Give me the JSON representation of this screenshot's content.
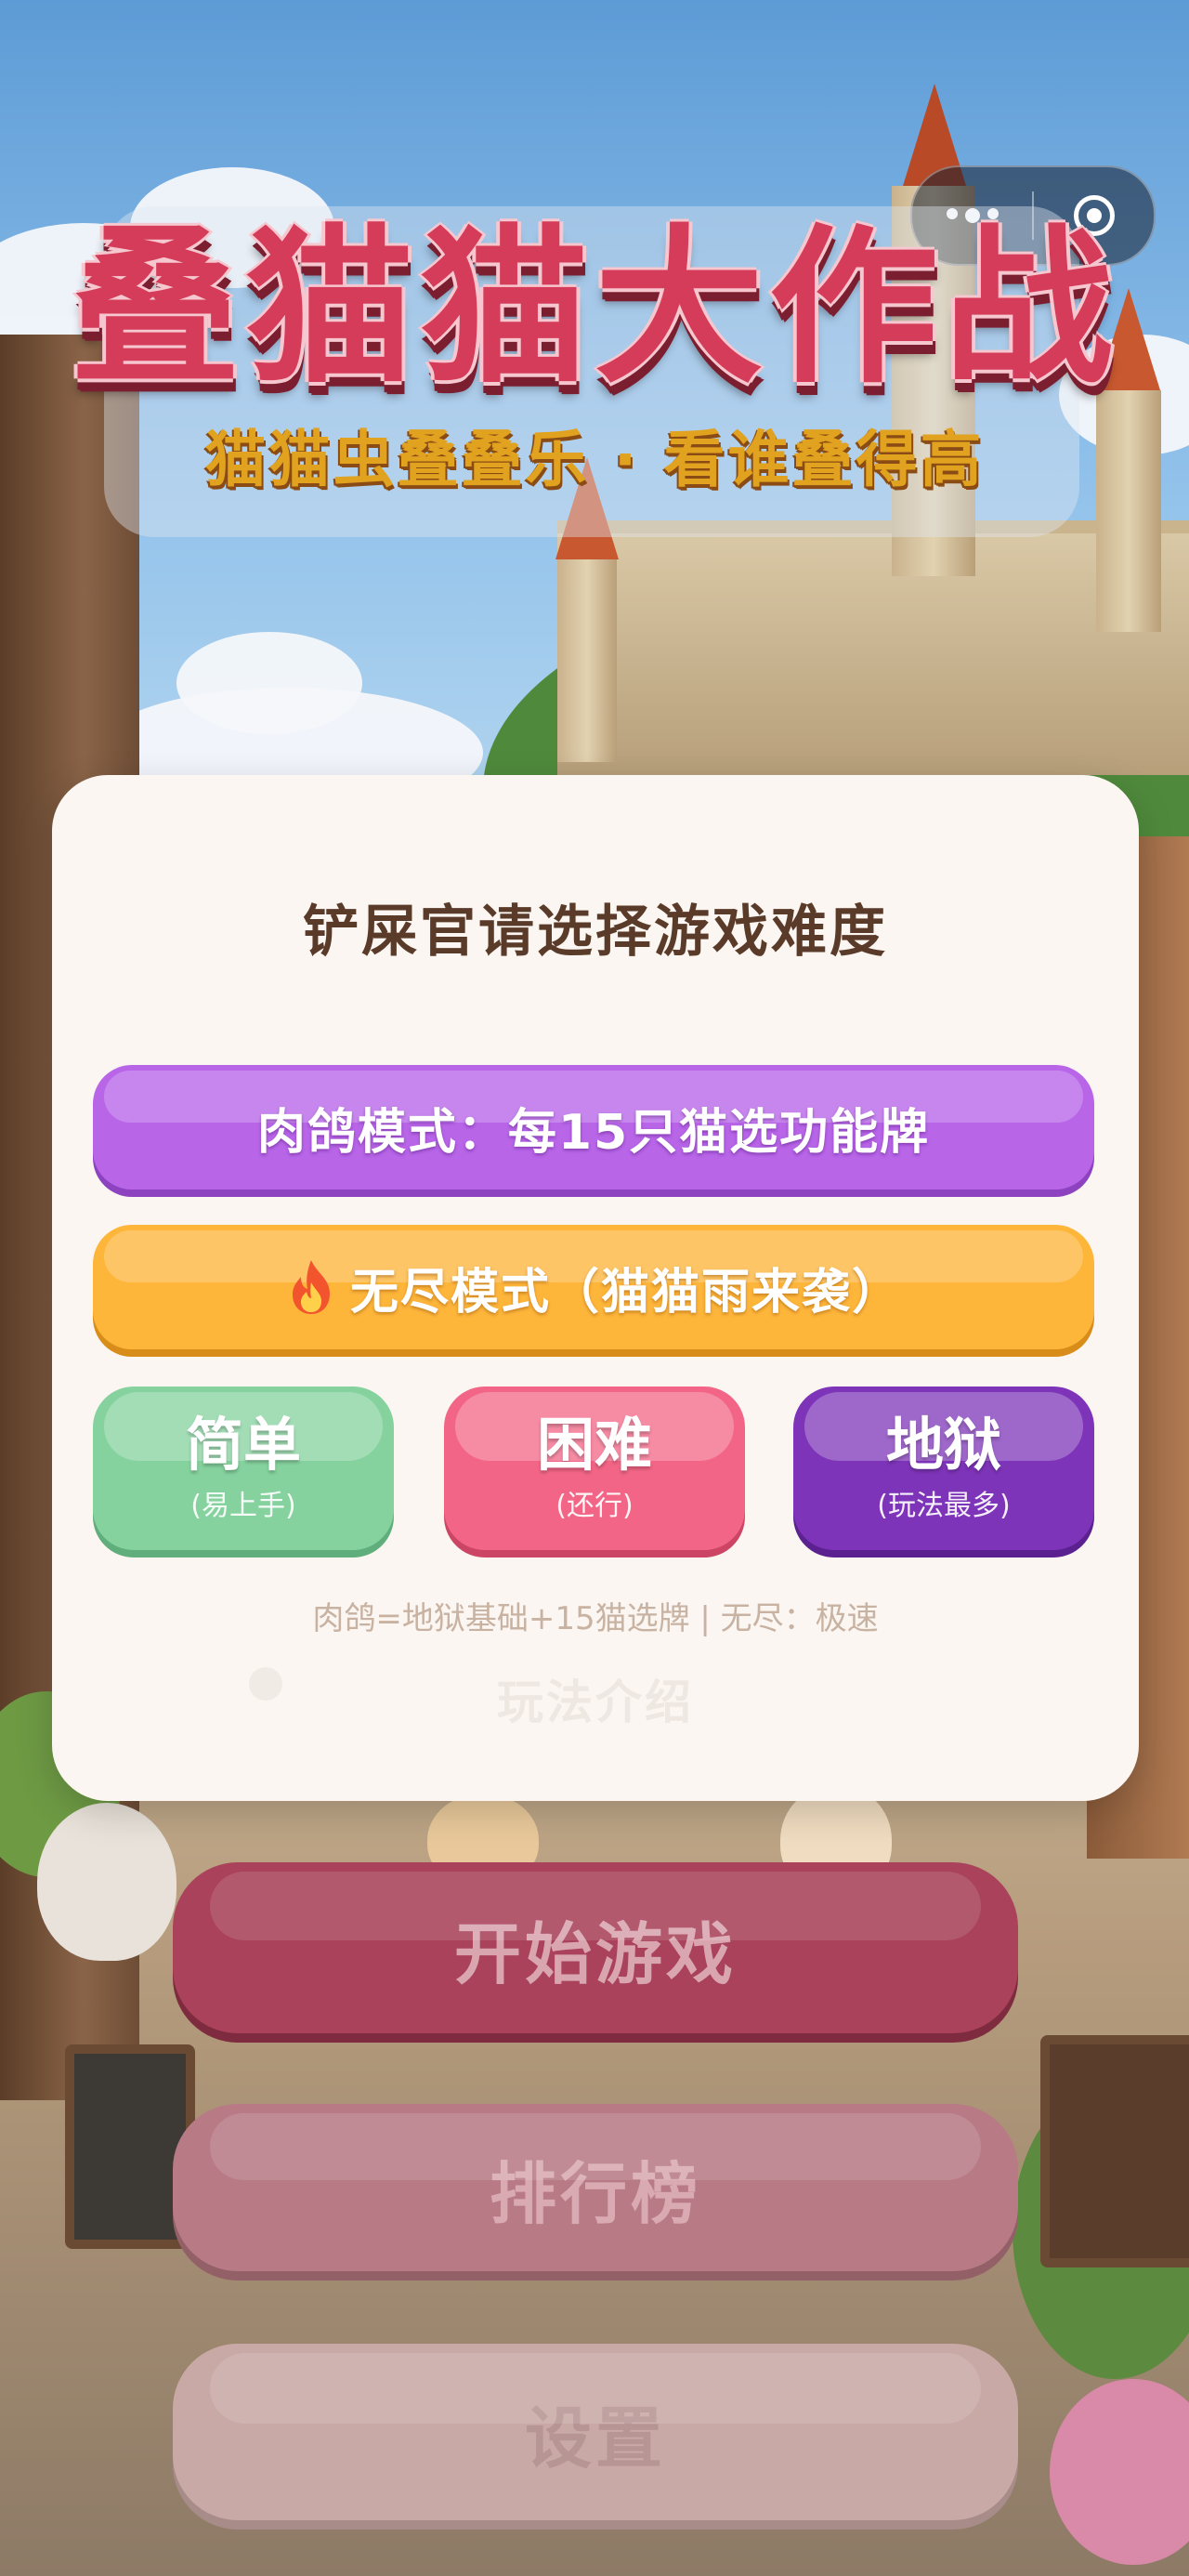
{
  "header": {
    "title": "叠猫猫大作战",
    "subtitle": "猫猫虫叠叠乐 · 看谁叠得高"
  },
  "capsule": {
    "menu_icon": "more-dots-icon",
    "close_icon": "target-close-icon"
  },
  "dialog": {
    "title": "铲屎官请选择游戏难度",
    "modes": [
      {
        "label": "肉鸽模式：每15只猫选功能牌",
        "color": "#b865e8"
      },
      {
        "label": "无尽模式（猫猫雨来袭）",
        "icon": "fire-icon",
        "color": "#fdb53a"
      }
    ],
    "difficulties": [
      {
        "label": "简单",
        "sub": "(易上手)",
        "color": "#85d29e"
      },
      {
        "label": "困难",
        "sub": "(还行)",
        "color": "#f36586"
      },
      {
        "label": "地狱",
        "sub": "(玩法最多)",
        "color": "#7e34b9"
      }
    ],
    "note": "肉鸽=地狱基础+15猫选牌 | 无尽：极速",
    "behind_label": "玩法介绍"
  },
  "main_menu": {
    "start": "开始游戏",
    "leaderboard": "排行榜",
    "settings": "设置"
  }
}
